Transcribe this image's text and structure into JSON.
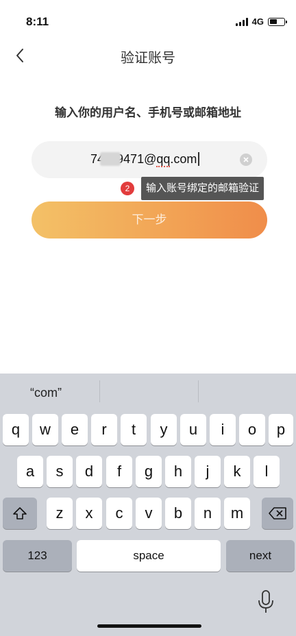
{
  "status_bar": {
    "time": "8:11",
    "network": "4G"
  },
  "nav": {
    "title": "验证账号"
  },
  "prompt": "输入你的用户名、手机号或邮箱地址",
  "input": {
    "value_prefix": "74",
    "value_middle": "9471@",
    "value_squiggle": "qq",
    "value_suffix": ".com"
  },
  "annotation": {
    "badge": "2",
    "tooltip": "输入账号绑定的邮箱验证"
  },
  "next_button": {
    "label": "下一步"
  },
  "keyboard": {
    "suggestions": [
      "“com”",
      "",
      ""
    ],
    "row1": [
      "q",
      "w",
      "e",
      "r",
      "t",
      "y",
      "u",
      "i",
      "o",
      "p"
    ],
    "row2": [
      "a",
      "s",
      "d",
      "f",
      "g",
      "h",
      "j",
      "k",
      "l"
    ],
    "row3": [
      "z",
      "x",
      "c",
      "v",
      "b",
      "n",
      "m"
    ],
    "numbers_label": "123",
    "space_label": "space",
    "next_label": "next"
  }
}
